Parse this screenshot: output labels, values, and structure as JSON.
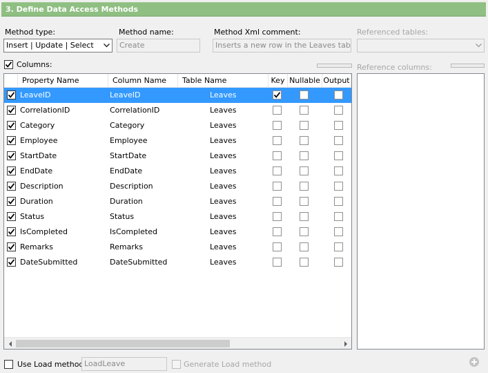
{
  "header": {
    "title": "3. Define Data Access Methods"
  },
  "method_type": {
    "label": "Method type:",
    "value": "Insert | Update | Select"
  },
  "method_name": {
    "label": "Method name:",
    "value": "Create"
  },
  "method_xml_comment": {
    "label": "Method Xml comment:",
    "value": "Inserts a new row in the Leaves table."
  },
  "referenced_tables": {
    "label": "Referenced tables:",
    "value": ""
  },
  "columns_toggle": {
    "label": "Columns:",
    "checked": true
  },
  "reference_columns": {
    "label": "Reference columns:"
  },
  "grid": {
    "headers": {
      "property_name": "Property Name",
      "column_name": "Column Name",
      "table_name": "Table Name",
      "key": "Key",
      "nullable": "Nullable",
      "output": "Output"
    },
    "rows": [
      {
        "property": "LeaveID",
        "column": "LeaveID",
        "table": "Leaves",
        "key": true,
        "nullable": false,
        "output": false
      },
      {
        "property": "CorrelationID",
        "column": "CorrelationID",
        "table": "Leaves",
        "key": false,
        "nullable": false,
        "output": false
      },
      {
        "property": "Category",
        "column": "Category",
        "table": "Leaves",
        "key": false,
        "nullable": false,
        "output": false
      },
      {
        "property": "Employee",
        "column": "Employee",
        "table": "Leaves",
        "key": false,
        "nullable": false,
        "output": false
      },
      {
        "property": "StartDate",
        "column": "StartDate",
        "table": "Leaves",
        "key": false,
        "nullable": false,
        "output": false
      },
      {
        "property": "EndDate",
        "column": "EndDate",
        "table": "Leaves",
        "key": false,
        "nullable": false,
        "output": false
      },
      {
        "property": "Description",
        "column": "Description",
        "table": "Leaves",
        "key": false,
        "nullable": false,
        "output": false
      },
      {
        "property": "Duration",
        "column": "Duration",
        "table": "Leaves",
        "key": false,
        "nullable": false,
        "output": false
      },
      {
        "property": "Status",
        "column": "Status",
        "table": "Leaves",
        "key": false,
        "nullable": false,
        "output": false
      },
      {
        "property": "IsCompleted",
        "column": "IsCompleted",
        "table": "Leaves",
        "key": false,
        "nullable": false,
        "output": false
      },
      {
        "property": "Remarks",
        "column": "Remarks",
        "table": "Leaves",
        "key": false,
        "nullable": false,
        "output": false
      },
      {
        "property": "DateSubmitted",
        "column": "DateSubmitted",
        "table": "Leaves",
        "key": false,
        "nullable": false,
        "output": false
      }
    ],
    "selected_row": 0
  },
  "load_method": {
    "label": "Use Load method:",
    "checked": false,
    "value": "LoadLeave",
    "generate_label": "Generate Load method"
  },
  "colors": {
    "header_bg": "#8fbf82",
    "selection": "#3399ff",
    "window_bg": "#f0f0f0"
  },
  "icons": {
    "combo_arrow": "chevron-down-icon",
    "add": "plus-circle-icon",
    "scroll_left": "arrow-left-icon",
    "scroll_right": "arrow-right-icon"
  }
}
